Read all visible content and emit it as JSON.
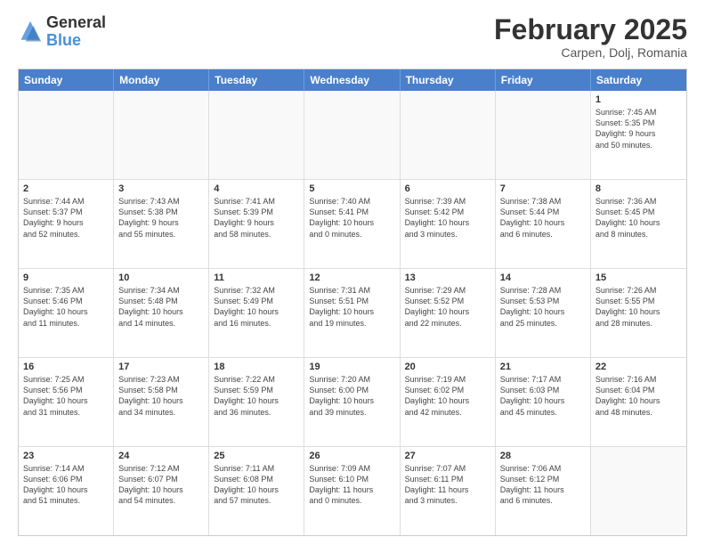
{
  "header": {
    "logo_general": "General",
    "logo_blue": "Blue",
    "month_title": "February 2025",
    "subtitle": "Carpen, Dolj, Romania"
  },
  "weekdays": [
    "Sunday",
    "Monday",
    "Tuesday",
    "Wednesday",
    "Thursday",
    "Friday",
    "Saturday"
  ],
  "rows": [
    [
      {
        "day": "",
        "info": ""
      },
      {
        "day": "",
        "info": ""
      },
      {
        "day": "",
        "info": ""
      },
      {
        "day": "",
        "info": ""
      },
      {
        "day": "",
        "info": ""
      },
      {
        "day": "",
        "info": ""
      },
      {
        "day": "1",
        "info": "Sunrise: 7:45 AM\nSunset: 5:35 PM\nDaylight: 9 hours\nand 50 minutes."
      }
    ],
    [
      {
        "day": "2",
        "info": "Sunrise: 7:44 AM\nSunset: 5:37 PM\nDaylight: 9 hours\nand 52 minutes."
      },
      {
        "day": "3",
        "info": "Sunrise: 7:43 AM\nSunset: 5:38 PM\nDaylight: 9 hours\nand 55 minutes."
      },
      {
        "day": "4",
        "info": "Sunrise: 7:41 AM\nSunset: 5:39 PM\nDaylight: 9 hours\nand 58 minutes."
      },
      {
        "day": "5",
        "info": "Sunrise: 7:40 AM\nSunset: 5:41 PM\nDaylight: 10 hours\nand 0 minutes."
      },
      {
        "day": "6",
        "info": "Sunrise: 7:39 AM\nSunset: 5:42 PM\nDaylight: 10 hours\nand 3 minutes."
      },
      {
        "day": "7",
        "info": "Sunrise: 7:38 AM\nSunset: 5:44 PM\nDaylight: 10 hours\nand 6 minutes."
      },
      {
        "day": "8",
        "info": "Sunrise: 7:36 AM\nSunset: 5:45 PM\nDaylight: 10 hours\nand 8 minutes."
      }
    ],
    [
      {
        "day": "9",
        "info": "Sunrise: 7:35 AM\nSunset: 5:46 PM\nDaylight: 10 hours\nand 11 minutes."
      },
      {
        "day": "10",
        "info": "Sunrise: 7:34 AM\nSunset: 5:48 PM\nDaylight: 10 hours\nand 14 minutes."
      },
      {
        "day": "11",
        "info": "Sunrise: 7:32 AM\nSunset: 5:49 PM\nDaylight: 10 hours\nand 16 minutes."
      },
      {
        "day": "12",
        "info": "Sunrise: 7:31 AM\nSunset: 5:51 PM\nDaylight: 10 hours\nand 19 minutes."
      },
      {
        "day": "13",
        "info": "Sunrise: 7:29 AM\nSunset: 5:52 PM\nDaylight: 10 hours\nand 22 minutes."
      },
      {
        "day": "14",
        "info": "Sunrise: 7:28 AM\nSunset: 5:53 PM\nDaylight: 10 hours\nand 25 minutes."
      },
      {
        "day": "15",
        "info": "Sunrise: 7:26 AM\nSunset: 5:55 PM\nDaylight: 10 hours\nand 28 minutes."
      }
    ],
    [
      {
        "day": "16",
        "info": "Sunrise: 7:25 AM\nSunset: 5:56 PM\nDaylight: 10 hours\nand 31 minutes."
      },
      {
        "day": "17",
        "info": "Sunrise: 7:23 AM\nSunset: 5:58 PM\nDaylight: 10 hours\nand 34 minutes."
      },
      {
        "day": "18",
        "info": "Sunrise: 7:22 AM\nSunset: 5:59 PM\nDaylight: 10 hours\nand 36 minutes."
      },
      {
        "day": "19",
        "info": "Sunrise: 7:20 AM\nSunset: 6:00 PM\nDaylight: 10 hours\nand 39 minutes."
      },
      {
        "day": "20",
        "info": "Sunrise: 7:19 AM\nSunset: 6:02 PM\nDaylight: 10 hours\nand 42 minutes."
      },
      {
        "day": "21",
        "info": "Sunrise: 7:17 AM\nSunset: 6:03 PM\nDaylight: 10 hours\nand 45 minutes."
      },
      {
        "day": "22",
        "info": "Sunrise: 7:16 AM\nSunset: 6:04 PM\nDaylight: 10 hours\nand 48 minutes."
      }
    ],
    [
      {
        "day": "23",
        "info": "Sunrise: 7:14 AM\nSunset: 6:06 PM\nDaylight: 10 hours\nand 51 minutes."
      },
      {
        "day": "24",
        "info": "Sunrise: 7:12 AM\nSunset: 6:07 PM\nDaylight: 10 hours\nand 54 minutes."
      },
      {
        "day": "25",
        "info": "Sunrise: 7:11 AM\nSunset: 6:08 PM\nDaylight: 10 hours\nand 57 minutes."
      },
      {
        "day": "26",
        "info": "Sunrise: 7:09 AM\nSunset: 6:10 PM\nDaylight: 11 hours\nand 0 minutes."
      },
      {
        "day": "27",
        "info": "Sunrise: 7:07 AM\nSunset: 6:11 PM\nDaylight: 11 hours\nand 3 minutes."
      },
      {
        "day": "28",
        "info": "Sunrise: 7:06 AM\nSunset: 6:12 PM\nDaylight: 11 hours\nand 6 minutes."
      },
      {
        "day": "",
        "info": ""
      }
    ]
  ]
}
